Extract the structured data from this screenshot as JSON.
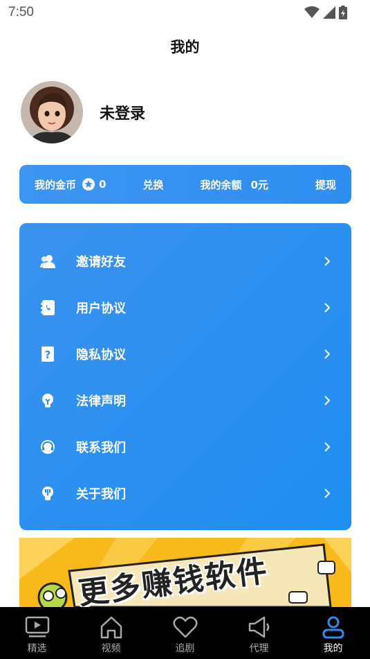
{
  "status_bar": {
    "time": "7:50"
  },
  "page_title": "我的",
  "profile": {
    "username": "未登录"
  },
  "wallet": {
    "coins_label": "我的金币",
    "coins_value": "0",
    "exchange_label": "兑换",
    "balance_label": "我的余额",
    "balance_value": "0元",
    "withdraw_label": "提现"
  },
  "menu": [
    {
      "label": "邀请好友",
      "icon": "users-icon"
    },
    {
      "label": "用户协议",
      "icon": "contact-book-icon"
    },
    {
      "label": "隐私协议",
      "icon": "question-icon"
    },
    {
      "label": "法律声明",
      "icon": "bulb-icon"
    },
    {
      "label": "联系我们",
      "icon": "headset-icon"
    },
    {
      "label": "关于我们",
      "icon": "info-bulb-icon"
    }
  ],
  "banner": {
    "text": "更多赚钱软件"
  },
  "tabs": [
    {
      "label": "精选",
      "icon": "play-screen-icon",
      "active": false
    },
    {
      "label": "视频",
      "icon": "home-icon",
      "active": false
    },
    {
      "label": "追剧",
      "icon": "heart-icon",
      "active": false
    },
    {
      "label": "代理",
      "icon": "megaphone-icon",
      "active": false
    },
    {
      "label": "我的",
      "icon": "user-icon",
      "active": true
    }
  ],
  "colors": {
    "accent": "#2e8ef0",
    "active_tab": "#2e8ef0",
    "tab_bar_bg": "#000000",
    "banner_bg": "#f8b91b"
  }
}
